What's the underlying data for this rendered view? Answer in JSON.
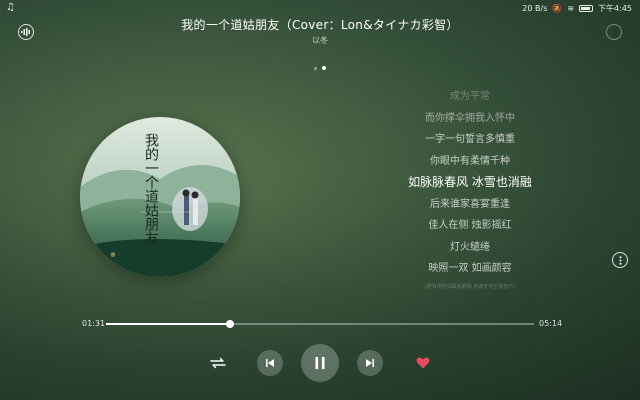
{
  "status": {
    "network_speed": "20 B/s",
    "time": "下午4:45"
  },
  "song": {
    "title": "我的一个道姑朋友（Cover：Lon&タイナカ彩智）",
    "artist": "以冬"
  },
  "icons": {
    "status_note": "music-note-icon",
    "top_left": "audio-effect-icon",
    "top_right": "settings-icon",
    "more": "more-options-icon",
    "mode": "repeat-icon",
    "prev": "skip-previous-icon",
    "play": "pause-icon",
    "next": "skip-next-icon",
    "like": "heart-icon"
  },
  "colors": {
    "like": "#e84a5f",
    "progress": "#ffffff"
  },
  "lyrics": [
    "成为平常",
    "而你撑伞拥我入怀中",
    "一字一句誓言多慎重",
    "你眼中有柔情千种",
    "如脉脉春风 冰雪也消融",
    "后来谁家喜宴重逢",
    "佳人在侧 烛影摇红",
    "灯火缱绻",
    "映照一双 如画颜容",
    "(若有侵权请联系删除 感谢支持正版音乐)"
  ],
  "current_lyric_index": 4,
  "playback": {
    "current_time": "01:31",
    "total_time": "05:14",
    "progress": 0.29
  },
  "pager": {
    "pages": 2,
    "active": 1
  },
  "album_art": {
    "title_text": "我的一个道姑朋友",
    "artist_text": "以冬"
  }
}
